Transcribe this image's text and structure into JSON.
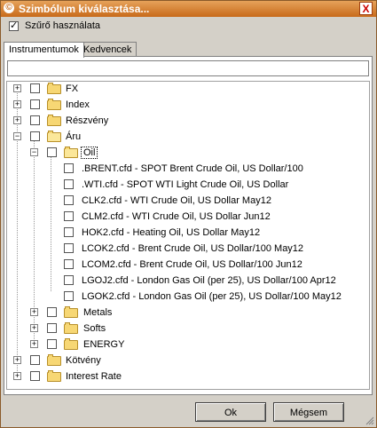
{
  "window": {
    "title": "Szimbólum kiválasztása...",
    "close_glyph": "X"
  },
  "filter": {
    "label": "Szűrő használata",
    "checked": true
  },
  "tabs": [
    {
      "label": "Instrumentumok",
      "active": true
    },
    {
      "label": "Kedvencek",
      "active": false
    }
  ],
  "search": {
    "value": ""
  },
  "tree": {
    "fx": "FX",
    "index": "Index",
    "reszveny": "Részvény",
    "aru": "Áru",
    "oil": "Oil",
    "items": [
      ".BRENT.cfd - SPOT Brent Crude Oil, US Dollar/100",
      ".WTI.cfd - SPOT WTI Light Crude Oil, US Dollar",
      "CLK2.cfd - WTI Crude Oil, US Dollar May12",
      "CLM2.cfd - WTI Crude Oil, US Dollar Jun12",
      "HOK2.cfd - Heating Oil, US Dollar May12",
      "LCOK2.cfd - Brent Crude Oil, US Dollar/100 May12",
      "LCOM2.cfd - Brent Crude Oil, US Dollar/100 Jun12",
      "LGOJ2.cfd - London Gas Oil (per 25), US Dollar/100 Apr12",
      "LGOK2.cfd - London Gas Oil (per 25), US Dollar/100 May12"
    ],
    "metals": "Metals",
    "softs": "Softs",
    "energy": "ENERGY",
    "kotveny": "Kötvény",
    "interest": "Interest Rate"
  },
  "buttons": {
    "ok": "Ok",
    "cancel": "Mégsem"
  }
}
